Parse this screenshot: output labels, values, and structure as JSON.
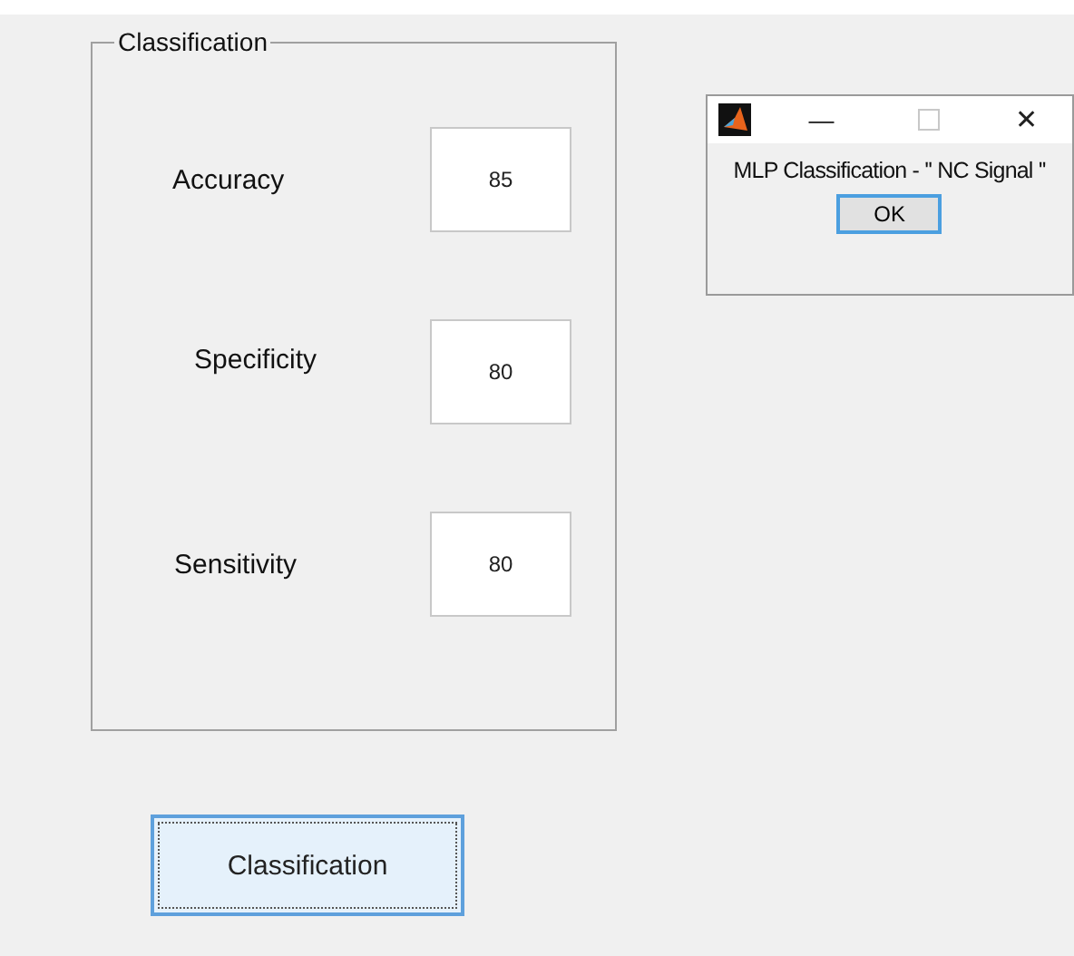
{
  "panel": {
    "title": "Classification",
    "fields": [
      {
        "label": "Accuracy",
        "value": "85"
      },
      {
        "label": "Specificity",
        "value": "80"
      },
      {
        "label": "Sensitivity",
        "value": "80"
      }
    ]
  },
  "button": {
    "label": "Classification",
    "focused": true
  },
  "dialog": {
    "minimize": "—",
    "close": "✕",
    "message": "MLP Classification - '' NC Signal ''",
    "ok": "OK"
  }
}
